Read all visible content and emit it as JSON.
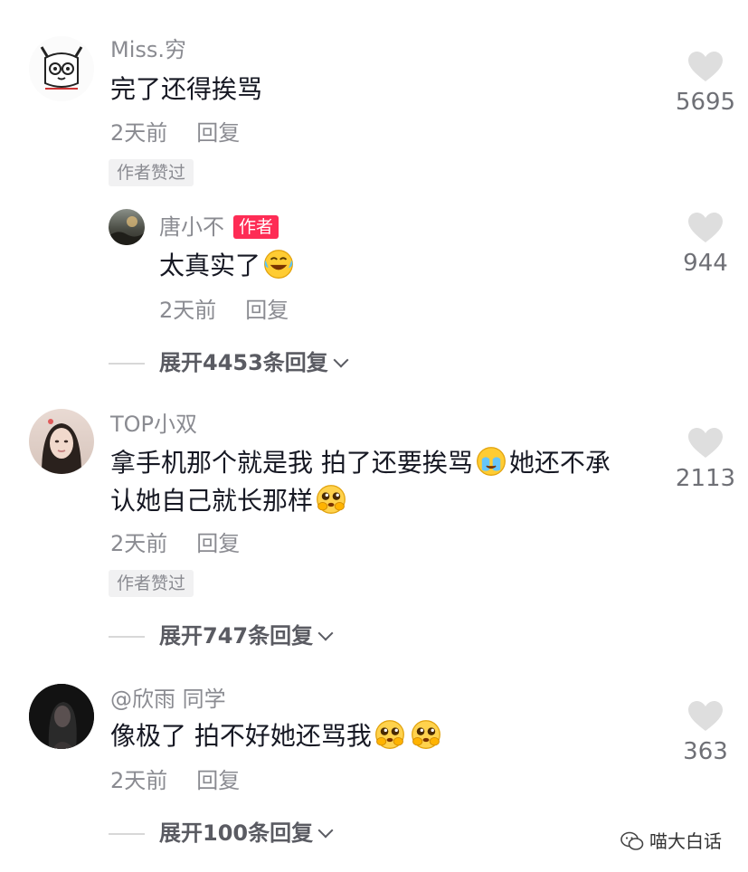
{
  "comments": [
    {
      "username": "Miss.穷",
      "avatar": "cartoon-avatar",
      "text": "完了还得挨骂",
      "time": "2天前",
      "reply_label": "回复",
      "author_liked_badge": "作者赞过",
      "likes": "5695",
      "sub_reply": {
        "username": "唐小不",
        "author_badge": "作者",
        "text": "太真实了",
        "emoji": "laughing-crying-emoji",
        "time": "2天前",
        "reply_label": "回复",
        "likes": "944"
      },
      "expand_label": "展开4453条回复"
    },
    {
      "username": "TOP小双",
      "avatar": "photo-avatar",
      "text_line1": "拿手机那个就是我 拍了还要挨骂",
      "text_line1b": "她还不承",
      "text_line2": "认她自己就长那样",
      "emoji": "crying-emoji",
      "emoji2": "pleading-emoji",
      "time": "2天前",
      "reply_label": "回复",
      "author_liked_badge": "作者赞过",
      "likes": "2113",
      "expand_label": "展开747条回复"
    },
    {
      "username": "@欣雨 同学",
      "avatar": "photo-avatar",
      "text": "像极了 拍不好她还骂我",
      "emoji": "pleading-emoji",
      "time": "2天前",
      "reply_label": "回复",
      "likes": "363",
      "expand_label": "展开100条回复"
    }
  ],
  "watermark": "喵大白话",
  "colors": {
    "accent": "#fe2c55",
    "secondary_text": "#8a8b91",
    "like_icon": "#e0e0e0"
  }
}
